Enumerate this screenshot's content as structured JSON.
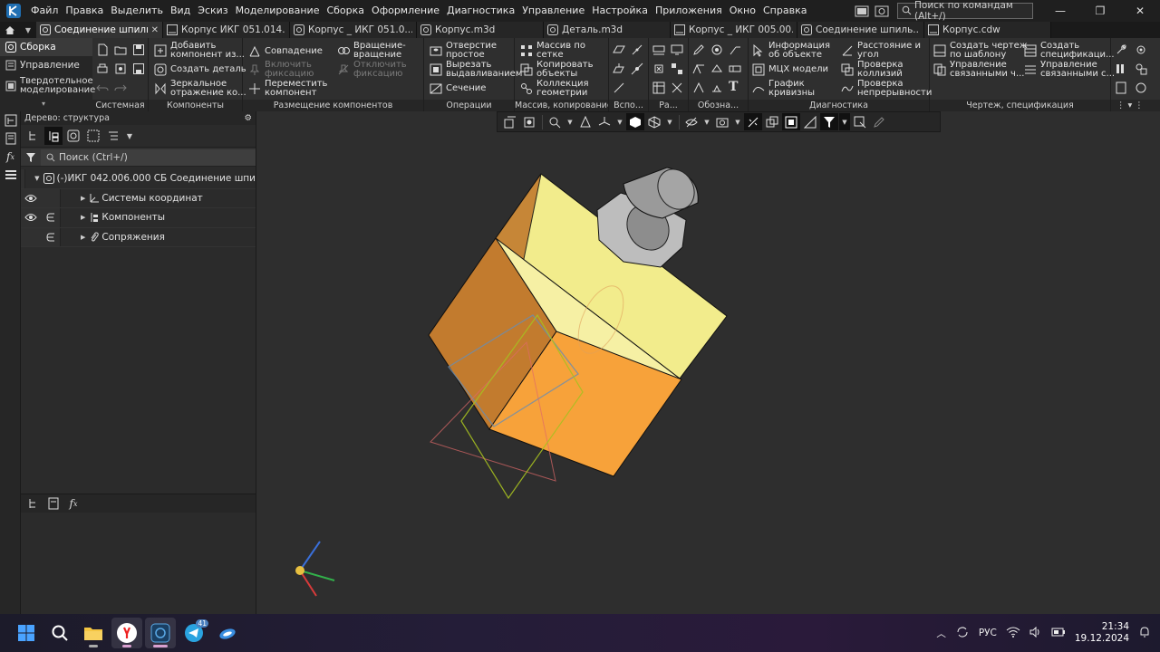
{
  "menu": {
    "items": [
      "Файл",
      "Правка",
      "Выделить",
      "Вид",
      "Эскиз",
      "Моделирование",
      "Сборка",
      "Оформление",
      "Диагностика",
      "Управление",
      "Настройка",
      "Приложения",
      "Окно",
      "Справка"
    ],
    "search_placeholder": "Поиск по командам (Alt+/)"
  },
  "tabs": [
    {
      "label": "Соединение шпиль...",
      "active": true
    },
    {
      "label": "Корпус ИКГ 051.014...",
      "active": false
    },
    {
      "label": "Корпус _ ИКГ 051.0...",
      "active": false
    },
    {
      "label": "Корпус.m3d",
      "active": false
    },
    {
      "label": "Деталь.m3d",
      "active": false
    },
    {
      "label": "Корпус _ ИКГ 005.00...",
      "active": false
    },
    {
      "label": "Соединение шпиль...",
      "active": false
    },
    {
      "label": "Корпус.cdw",
      "active": false
    }
  ],
  "ribbon": {
    "modes": [
      "Сборка",
      "Управление",
      "Твердотельное моделирование"
    ],
    "mode_line1": "Твердотельное",
    "mode_line2": "моделирование",
    "groups": {
      "system": "Системная",
      "components": "Компоненты",
      "placement": "Размещение компонентов",
      "operations": "Операции",
      "array": "Массив, копирование",
      "aux": "Вспо...",
      "ra": "Ра...",
      "oboz": "Обозна...",
      "diagnostics": "Диагностика",
      "drawing": "Чертеж, спецификация"
    },
    "components": {
      "add_1": "Добавить",
      "add_2": "компонент из...",
      "create": "Создать деталь",
      "mirror_1": "Зеркальное",
      "mirror_2": "отражение ко..."
    },
    "placement": {
      "coincide": "Совпадение",
      "fix_1": "Включить",
      "fix_2": "фиксацию",
      "move_1": "Переместить",
      "move_2": "компонент",
      "rot_1": "Вращение-",
      "rot_2": "вращение",
      "unfix_1": "Отключить",
      "unfix_2": "фиксацию"
    },
    "operations": {
      "hole_1": "Отверстие",
      "hole_2": "простое",
      "cut_1": "Вырезать",
      "cut_2": "выдавливанием",
      "section": "Сечение"
    },
    "array": {
      "grid_1": "Массив по",
      "grid_2": "сетке",
      "copy_1": "Копировать",
      "copy_2": "объекты",
      "coll_1": "Коллекция",
      "coll_2": "геометрии"
    },
    "diagnostics": {
      "info_1": "Информация",
      "info_2": "об объекте",
      "mcx": "МЦХ модели",
      "curv_1": "График",
      "curv_2": "кривизны",
      "dist_1": "Расстояние и",
      "dist_2": "угол",
      "coll_1": "Проверка",
      "coll_2": "коллизий",
      "cont_1": "Проверка",
      "cont_2": "непрерывности"
    },
    "drawing": {
      "tpl_1": "Создать чертеж",
      "tpl_2": "по шаблону",
      "mgr_1": "Управление",
      "mgr_2": "связанными ч...",
      "spec_1": "Создать",
      "spec_2": "спецификаци...",
      "mgs_1": "Управление",
      "mgs_2": "связанными с..."
    }
  },
  "tree": {
    "header": "Дерево: структура",
    "search_placeholder": "Поиск (Ctrl+/)",
    "root": "(-)ИКГ 042.006.000 СБ Соединение шпи",
    "rows": [
      "Системы координат",
      "Компоненты",
      "Сопряжения"
    ]
  },
  "taskbar": {
    "telegram_badge": "41",
    "lang": "РУС",
    "time": "21:34",
    "date": "19.12.2024"
  },
  "colors": {
    "accent": "#1f6fb3",
    "model_top": "#f2ec8c",
    "model_front": "#f7a23a",
    "model_side": "#c27b2e"
  }
}
